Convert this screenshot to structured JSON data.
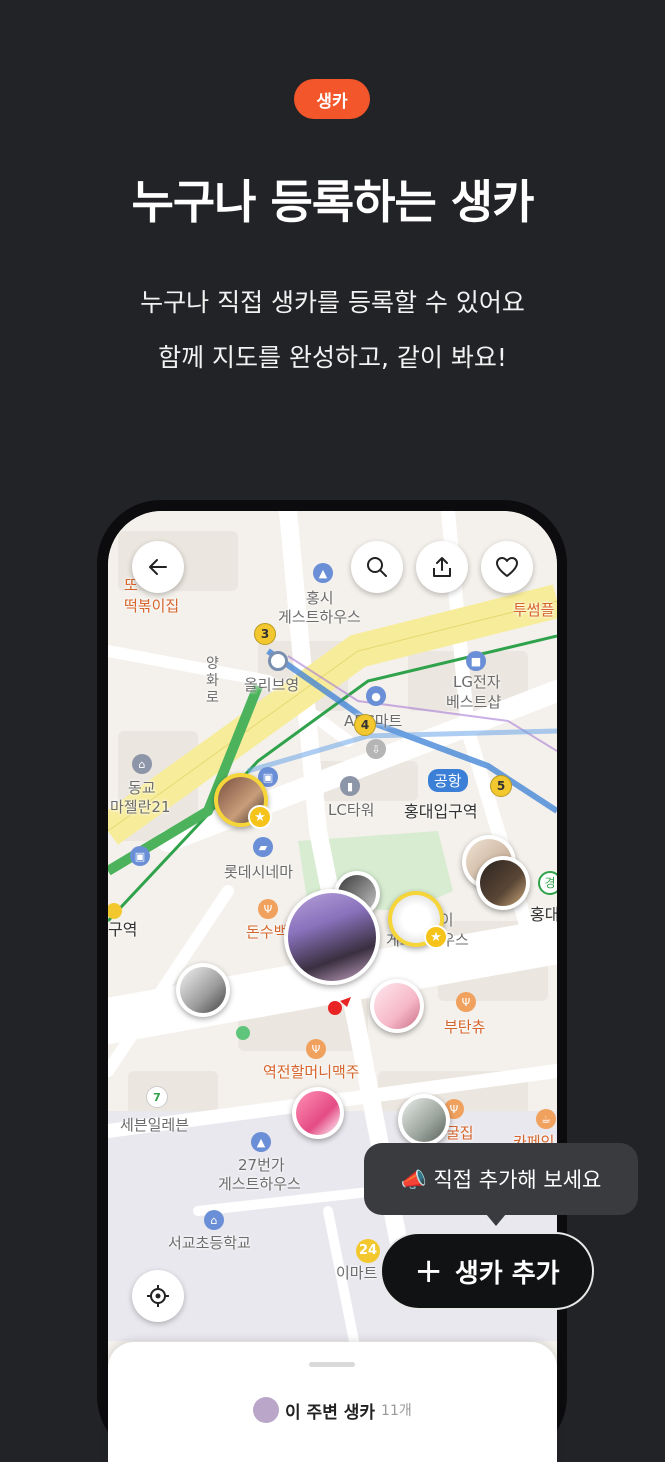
{
  "badge": "생카",
  "headline": "누구나 등록하는 생카",
  "desc_line1": "누구나 직접 생카를 등록할 수 있어요",
  "desc_line2": "함께 지도를 완성하고, 같이 봐요!",
  "map": {
    "labels": {
      "ddeok": "떡볶이집",
      "ddeok_top": "또",
      "hongsi": "홍시",
      "guesthouse1": "게스트하우스",
      "twosome": "투썸플",
      "yanghwa": "양화로",
      "olive": "올리브영",
      "lg1": "LG전자",
      "lg2": "베스트샵",
      "abc": "ABC마트",
      "tower": "LC타워",
      "airport": "공항",
      "hongik": "홍대입구역",
      "donggyo1": "동교",
      "donggyo2": "마젤란21",
      "lotte": "롯데시네마",
      "guyeok": "구역",
      "hong_r": "홍대",
      "gyeong": "경",
      "donsu": "돈수백",
      "guesthouse2a": "게스트하우스",
      "guesthouse2b": "데이",
      "butanchu": "부탄츄",
      "yeokjeon": "역전할머니맥주",
      "seven": "세븐일레븐",
      "gujip": "굴집",
      "cafe": "카페인",
      "guest27a": "27번가",
      "guest27b": "게스트하우스",
      "school": "서교초등학교",
      "emart": "이마트",
      "emart24": "24"
    },
    "line_numbers": [
      "3",
      "4",
      "5"
    ],
    "colors": {
      "accent": "#f2562a",
      "line2": "#2fa24b",
      "airport_line": "#3b7fd6",
      "road_yellow": "#f7ec9a",
      "pin_gold": "#f6d53b"
    }
  },
  "toolbar": {
    "back_icon": "back-arrow-icon",
    "search_icon": "search-icon",
    "share_icon": "share-icon",
    "favorite_icon": "heart-icon",
    "locate_icon": "my-location-icon"
  },
  "tooltip": "📣 직접 추가해 보세요",
  "add_button": {
    "plus": "+",
    "label": "생카 추가"
  },
  "sheet": {
    "title": "이 주변 생카",
    "count": "11개"
  }
}
